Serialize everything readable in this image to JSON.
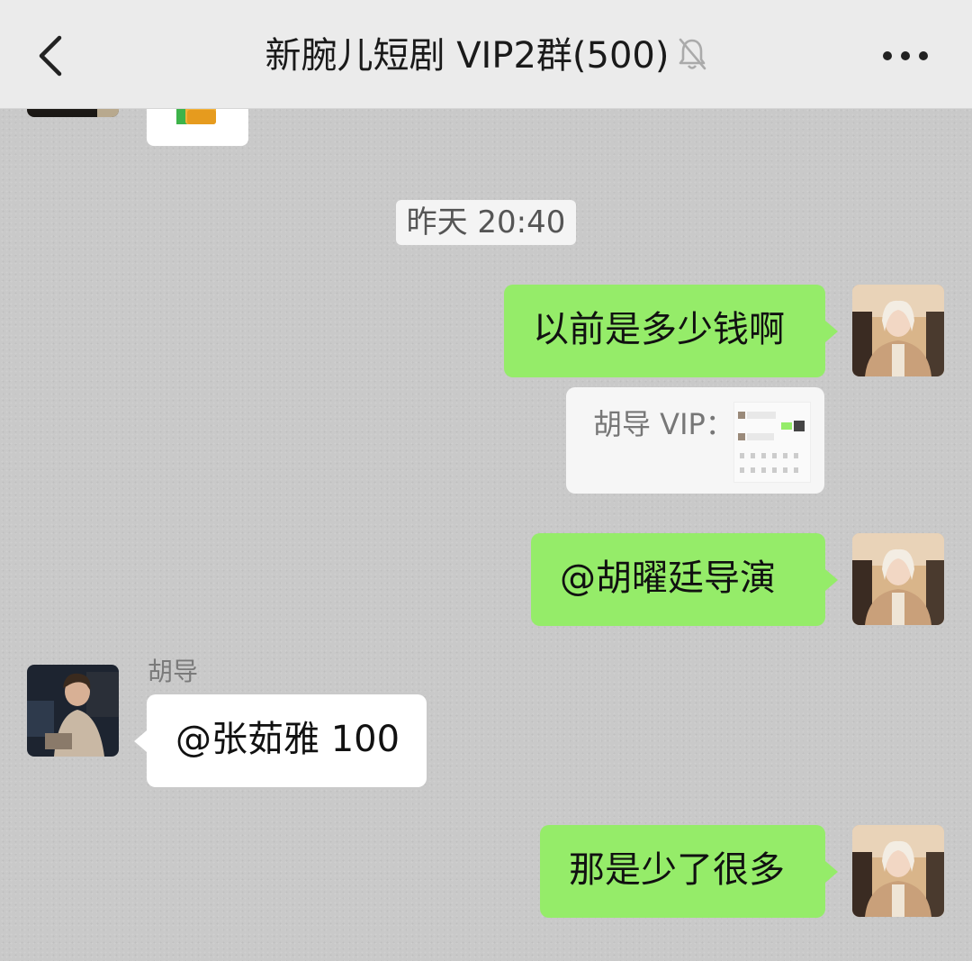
{
  "header": {
    "title": "新腕儿短剧 VIP2群(500)",
    "back_icon": "chevron-left-icon",
    "mute_icon": "bell-slash-icon",
    "more_icon": "ellipsis-icon"
  },
  "timestamp": "昨天 20:40",
  "messages": [
    {
      "side": "right",
      "text": "以前是多少钱啊"
    },
    {
      "side": "right",
      "quote": "胡导 VIP："
    },
    {
      "side": "right",
      "text": "@胡曜廷导演"
    },
    {
      "side": "left",
      "sender": "胡导",
      "text": "@张茹雅 100"
    },
    {
      "side": "right",
      "text": "那是少了很多"
    }
  ],
  "colors": {
    "bubble_self": "#95ec69",
    "bubble_other": "#ffffff",
    "background": "#c9c9c9",
    "header": "#ebebeb"
  }
}
